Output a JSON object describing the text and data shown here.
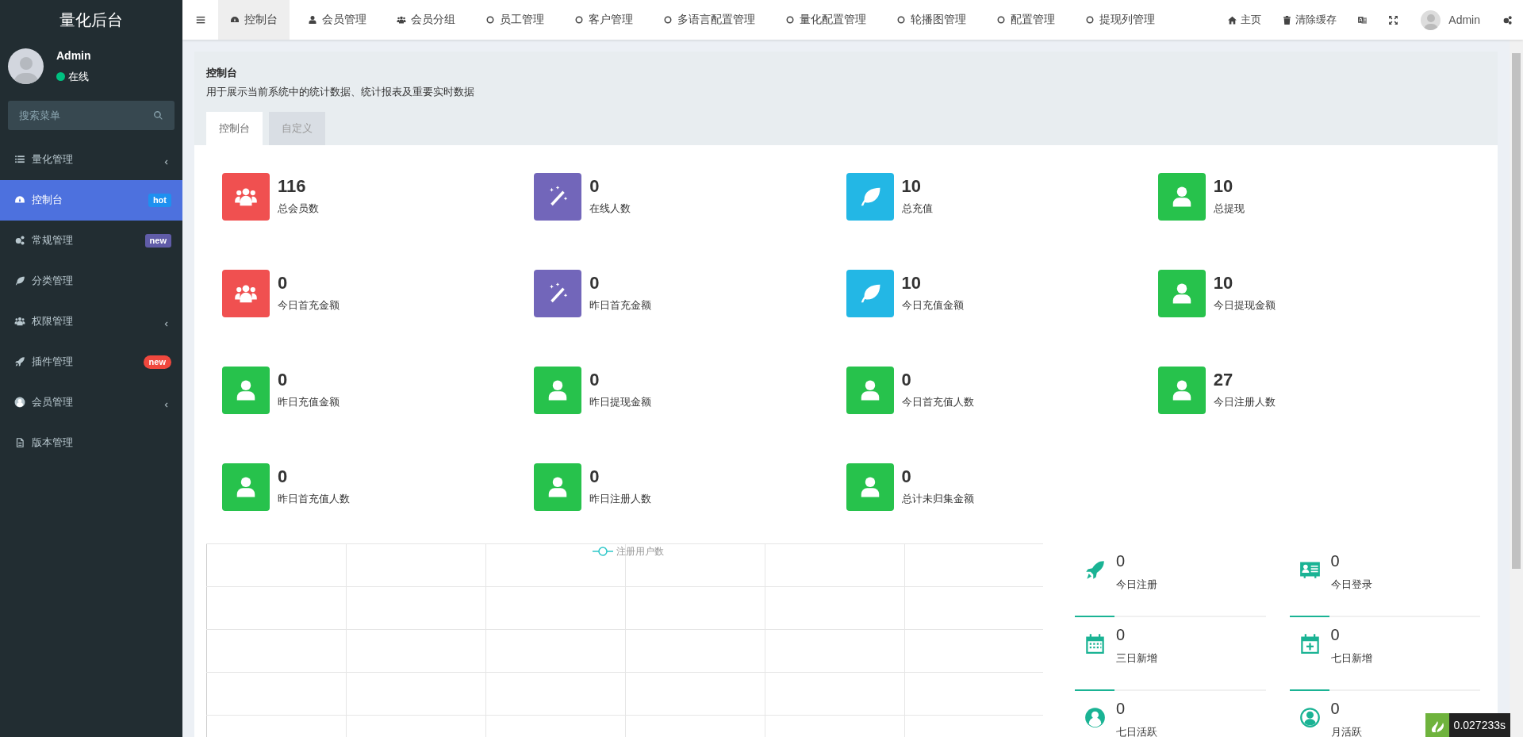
{
  "sidebar": {
    "logo": "量化后台",
    "user": {
      "name": "Admin",
      "status": "在线",
      "online": true
    },
    "search": {
      "placeholder": "搜索菜单"
    },
    "items": [
      {
        "label": "量化管理",
        "kind": "list",
        "expandable": true,
        "selected": false
      },
      {
        "label": "控制台",
        "kind": "gauge",
        "expandable": false,
        "selected": true,
        "badge": {
          "text": "hot",
          "color": "#1e90f0",
          "kind": "label"
        }
      },
      {
        "label": "常规管理",
        "kind": "gears",
        "expandable": false,
        "selected": false,
        "badge": {
          "text": "new",
          "color": "#605ca8",
          "kind": "label"
        }
      },
      {
        "label": "分类管理",
        "kind": "leaf",
        "expandable": false,
        "selected": false
      },
      {
        "label": "权限管理",
        "kind": "users",
        "expandable": true,
        "selected": false
      },
      {
        "label": "插件管理",
        "kind": "rocket",
        "expandable": false,
        "selected": false,
        "badge": {
          "text": "new",
          "color": "#f0483e",
          "kind": "pill"
        }
      },
      {
        "label": "会员管理",
        "kind": "user-circle",
        "expandable": true,
        "selected": false
      },
      {
        "label": "版本管理",
        "kind": "document",
        "expandable": false,
        "selected": false
      }
    ]
  },
  "topbar": {
    "tabs": [
      {
        "label": "控制台",
        "kind": "gauge",
        "selected": true
      },
      {
        "label": "会员管理",
        "kind": "user",
        "selected": false
      },
      {
        "label": "会员分组",
        "kind": "users",
        "selected": false
      },
      {
        "label": "员工管理",
        "kind": "circle",
        "selected": false
      },
      {
        "label": "客户管理",
        "kind": "circle",
        "selected": false
      },
      {
        "label": "多语言配置管理",
        "kind": "circle",
        "selected": false
      },
      {
        "label": "量化配置管理",
        "kind": "circle",
        "selected": false
      },
      {
        "label": "轮播图管理",
        "kind": "circle",
        "selected": false
      },
      {
        "label": "配置管理",
        "kind": "circle",
        "selected": false
      },
      {
        "label": "提现列管理",
        "kind": "circle",
        "selected": false
      }
    ],
    "actions": [
      {
        "kind": "home",
        "label": "主页"
      },
      {
        "kind": "trash",
        "label": "清除缓存"
      },
      {
        "kind": "translate"
      },
      {
        "kind": "expand"
      },
      {
        "kind": "avatar",
        "label": "Admin"
      },
      {
        "kind": "gears"
      }
    ]
  },
  "panel": {
    "title": "控制台",
    "description": "用于展示当前系统中的统计数据、统计报表及重要实时数据",
    "tabs": [
      {
        "label": "控制台",
        "selected": true
      },
      {
        "label": "自定义",
        "selected": false
      }
    ]
  },
  "stats": [
    {
      "value": "116",
      "label": "总会员数",
      "kind": "users",
      "color": "#f05050"
    },
    {
      "value": "0",
      "label": "在线人数",
      "kind": "magic",
      "color": "#7266ba"
    },
    {
      "value": "10",
      "label": "总充值",
      "kind": "leaf",
      "color": "#23b7e5"
    },
    {
      "value": "10",
      "label": "总提现",
      "kind": "user",
      "color": "#27c24c"
    },
    {
      "value": "0",
      "label": "今日首充金额",
      "kind": "users",
      "color": "#f05050"
    },
    {
      "value": "0",
      "label": "昨日首充金额",
      "kind": "magic",
      "color": "#7266ba"
    },
    {
      "value": "10",
      "label": "今日充值金额",
      "kind": "leaf",
      "color": "#23b7e5"
    },
    {
      "value": "10",
      "label": "今日提现金额",
      "kind": "user",
      "color": "#27c24c"
    },
    {
      "value": "0",
      "label": "昨日充值金额",
      "kind": "user",
      "color": "#27c24c"
    },
    {
      "value": "0",
      "label": "昨日提现金额",
      "kind": "user",
      "color": "#27c24c"
    },
    {
      "value": "0",
      "label": "今日首充值人数",
      "kind": "user",
      "color": "#27c24c"
    },
    {
      "value": "27",
      "label": "今日注册人数",
      "kind": "user",
      "color": "#27c24c"
    },
    {
      "value": "0",
      "label": "昨日首充值人数",
      "kind": "user",
      "color": "#27c24c"
    },
    {
      "value": "0",
      "label": "昨日注册人数",
      "kind": "user",
      "color": "#27c24c"
    },
    {
      "value": "0",
      "label": "总计未归集金额",
      "kind": "user",
      "color": "#27c24c"
    }
  ],
  "chart": {
    "legend": "注册用户数"
  },
  "mini_stats": [
    {
      "value": "0",
      "label": "今日注册",
      "kind": "rocket"
    },
    {
      "value": "0",
      "label": "今日登录",
      "kind": "id-card"
    },
    {
      "value": "0",
      "label": "三日新增",
      "kind": "calendar"
    },
    {
      "value": "0",
      "label": "七日新增",
      "kind": "calendar-plus"
    },
    {
      "value": "0",
      "label": "七日活跃",
      "kind": "user-circle"
    },
    {
      "value": "0",
      "label": "月活跃",
      "kind": "user-circle-outline"
    }
  ],
  "debug": {
    "time": "0.027233s"
  }
}
